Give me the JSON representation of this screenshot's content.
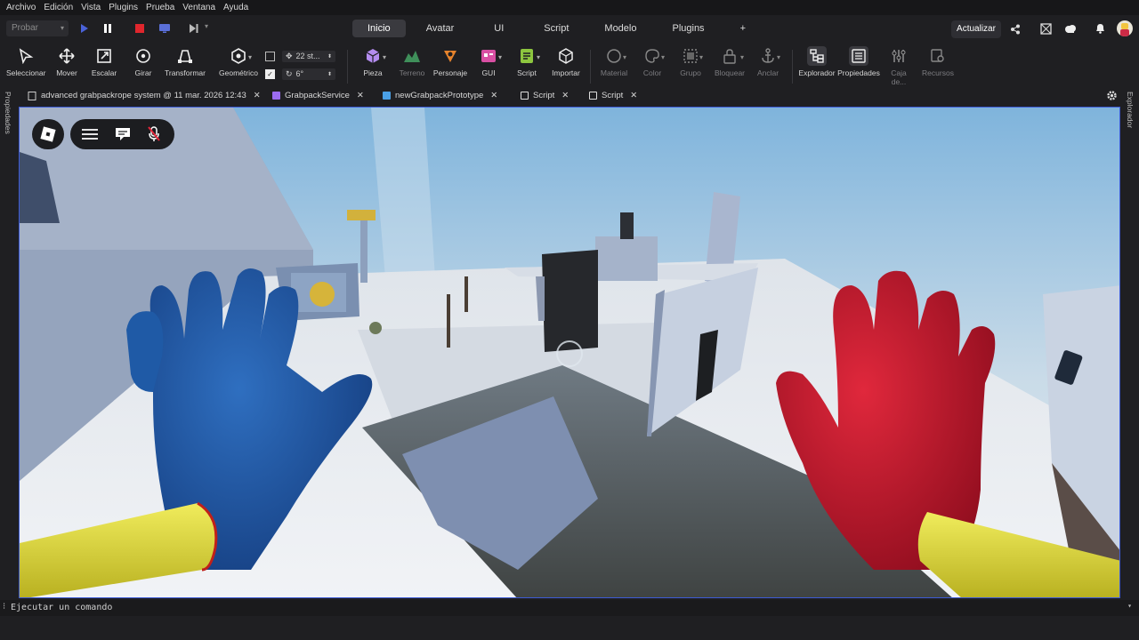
{
  "menu": [
    "Archivo",
    "Edición",
    "Vista",
    "Plugins",
    "Prueba",
    "Ventana",
    "Ayuda"
  ],
  "topbar": {
    "test_dropdown": "Probar",
    "tabs": [
      "Inicio",
      "Avatar",
      "UI",
      "Script",
      "Modelo",
      "Plugins",
      "+"
    ],
    "active_tab": "Inicio",
    "update_button": "Actualizar"
  },
  "ribbon": {
    "tools": [
      "Seleccionar",
      "Mover",
      "Escalar",
      "Girar",
      "Transformar",
      "Geométrico"
    ],
    "move_increment": "22 st...",
    "rotate_increment": "6°",
    "insert": [
      "Pieza",
      "Terreno",
      "Personaje",
      "GUI",
      "Script",
      "Importar"
    ],
    "edit": [
      "Material",
      "Color",
      "Grupo",
      "Bloquear",
      "Anclar"
    ],
    "panels": [
      "Explorador",
      "Propiedades",
      "Caja de...",
      "Recursos"
    ]
  },
  "doc_tabs": [
    {
      "label": "advanced grabpackrope system @ 11 mar. 2026 12:43",
      "color": "#d0d0d0"
    },
    {
      "label": "GrabpackService",
      "color": "#9b6cf0"
    },
    {
      "label": "newGrabpackPrototype",
      "color": "#4aa0e6"
    },
    {
      "label": "Script",
      "color": "#d8d8d8"
    },
    {
      "label": "Script",
      "color": "#d8d8d8"
    }
  ],
  "side": {
    "left": "Propiedades",
    "right": "Explorador"
  },
  "command_bar": {
    "placeholder": "Ejecutar un comando"
  },
  "colors": {
    "accent": "#3d5bd6",
    "blue_hand": "#1e5aa8",
    "red_hand": "#c8142c",
    "yellow_arm": "#e8e440"
  }
}
